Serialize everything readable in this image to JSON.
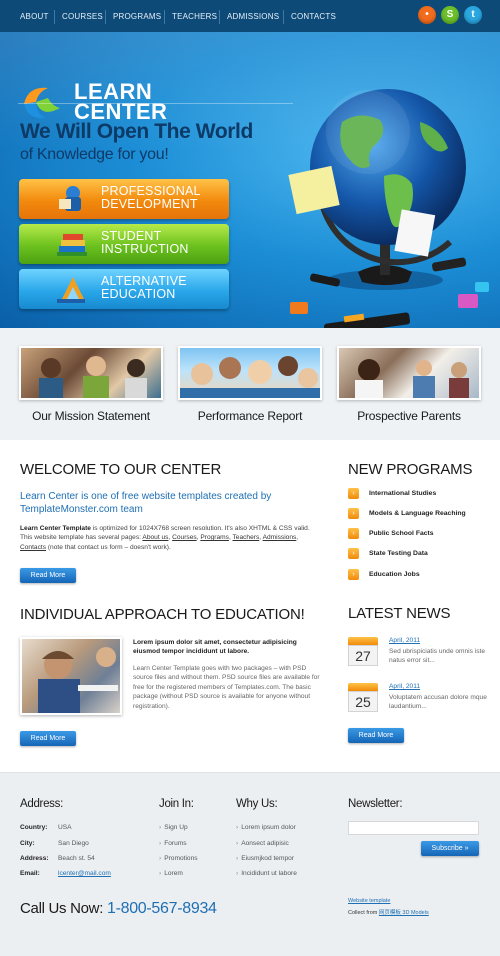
{
  "nav": {
    "items": [
      "ABOUT",
      "COURSES",
      "PROGRAMS",
      "TEACHERS",
      "ADMISSIONS",
      "CONTACTS"
    ],
    "social": [
      {
        "name": "flickr",
        "glyph": "•",
        "color": "#f26c1e"
      },
      {
        "name": "skype",
        "glyph": "S",
        "color": "#6cbf2a"
      },
      {
        "name": "twitter",
        "glyph": "t",
        "color": "#2aa7e0"
      }
    ]
  },
  "hero": {
    "logo_line1": "LEARN",
    "logo_line2": "CENTER",
    "title": "We Will Open The World",
    "subtitle": "of Knowledge for you!",
    "buttons": [
      {
        "line1": "PROFESSIONAL",
        "line2": "DEVELOPMENT",
        "color": "orange",
        "icon": "graduate-icon"
      },
      {
        "line1": "STUDENT",
        "line2": "INSTRUCTION",
        "color": "green",
        "icon": "books-icon"
      },
      {
        "line1": "ALTERNATIVE",
        "line2": "EDUCATION",
        "color": "blue",
        "icon": "triangle-ruler-icon"
      }
    ]
  },
  "features": [
    {
      "caption": "Our Mission Statement"
    },
    {
      "caption": "Performance Report"
    },
    {
      "caption": "Prospective Parents"
    }
  ],
  "welcome": {
    "heading": "WELCOME TO OUR CENTER",
    "lead": "Learn Center is one of free website templates created by TemplateMonster.com team",
    "body_bold": "Learn Center Template",
    "body_1": " is optimized for 1024X768 screen resolution. It's also XHTML & CSS valid. This website template has several pages: ",
    "links": [
      "About us",
      "Courses",
      "Programs",
      "Teachers",
      "Admissions",
      "Contacts"
    ],
    "body_2": " (note that contact us form – doesn't work).",
    "read_more": "Read More"
  },
  "programs": {
    "heading": "NEW PROGRAMS",
    "items": [
      "International Studies",
      "Models & Language Reaching",
      "Public School Facts",
      "State Testing Data",
      "Education Jobs"
    ]
  },
  "approach": {
    "heading": "INDIVIDUAL APPROACH TO EDUCATION!",
    "bold": "Lorem ipsum dolor sit amet, consectetur adipisicing eiusmod tempor incididunt ut labore.",
    "text": "Learn Center Template goes with two packages – with PSD source files and without them. PSD source files are available for free for the registered members of Templates.com. The basic package (without PSD source is available for anyone without registration).",
    "read_more": "Read More"
  },
  "news": {
    "heading": "LATEST NEWS",
    "items": [
      {
        "day": "27",
        "date": "April, 2011",
        "text": "Sed ubrispiciatis unde omnis iste natus error sit..."
      },
      {
        "day": "25",
        "date": "April, 2011",
        "text": "Voluptatem accusan dolore mque laudantium..."
      }
    ],
    "read_more": "Read More"
  },
  "footer": {
    "address_heading": "Address:",
    "address": [
      {
        "label": "Country:",
        "value": "USA"
      },
      {
        "label": "City:",
        "value": "San Diego"
      },
      {
        "label": "Address:",
        "value": "Beach st. 54"
      },
      {
        "label": "Email:",
        "value": "lcenter@mail.com"
      }
    ],
    "join_heading": "Join In:",
    "join": [
      "Sign Up",
      "Forums",
      "Promotions",
      "Lorem"
    ],
    "why_heading": "Why Us:",
    "why": [
      "Lorem ipsum dolor",
      "Aonsect adipisic",
      "Eiusmjkod tempor",
      "Incididunt ut labore"
    ],
    "newsletter_heading": "Newsletter:",
    "subscribe": "Subscribe »",
    "call_label": "Call Us Now:",
    "call_number": "1-800-567-8934",
    "website_template": "Website template",
    "collect_from": "Collect from ",
    "collect_link": "网页模板 3D Models"
  },
  "colors": {
    "nav": "#0d4a78",
    "accent_blue": "#1e6fb3",
    "orange": "#f08a0c",
    "green": "#6cc11e"
  }
}
